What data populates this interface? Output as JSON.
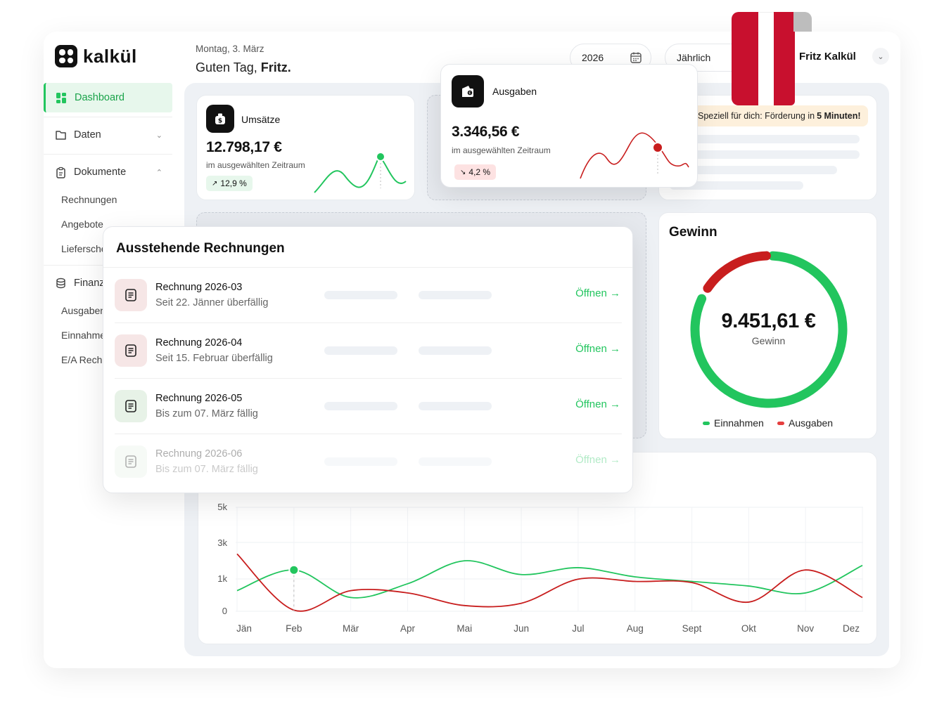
{
  "app": {
    "brand": "kalkül"
  },
  "header": {
    "date": "Montag, 3. März",
    "greeting_prefix": "Guten Tag,",
    "greeting_name": "Fritz.",
    "year": "2026",
    "period": "Jährlich",
    "user": "Fritz Kalkül"
  },
  "sidebar": {
    "dashboard": "Dashboard",
    "daten": "Daten",
    "dokumente": "Dokumente",
    "dokumente_items": [
      "Rechnungen",
      "Angebote",
      "Lieferscheine"
    ],
    "finanzen": "Finanzen",
    "finanzen_items": [
      "Ausgaben",
      "Einnahmen",
      "E/A Rechnung"
    ]
  },
  "umsaetze": {
    "title": "Umsätze",
    "value": "12.798,17 €",
    "sub": "im ausgewählten Zeitraum",
    "badge": "12,9 %"
  },
  "ausgaben": {
    "title": "Ausgaben",
    "value": "3.346,56 €",
    "sub": "im ausgewählten Zeitraum",
    "badge": "4,2 %"
  },
  "promo": {
    "text": "Speziell für dich: Förderung in ",
    "highlight": "5 Minuten!"
  },
  "invoices": {
    "title": "Ausstehende Rechnungen",
    "open_label": "Öffnen →",
    "rows": [
      {
        "name": "Rechnung 2026-03",
        "status": "Seit 22. Jänner überfällig",
        "tone": "red"
      },
      {
        "name": "Rechnung 2026-04",
        "status": "Seit 15. Februar überfällig",
        "tone": "red"
      },
      {
        "name": "Rechnung 2026-05",
        "status": "Bis zum 07. März fällig",
        "tone": "green"
      },
      {
        "name": "Rechnung 2026-06",
        "status": "Bis zum 07. März fällig",
        "tone": "green"
      }
    ]
  },
  "gewinn": {
    "title": "Gewinn",
    "value": "9.451,61 €",
    "label": "Gewinn",
    "legend_income": "Einnahmen",
    "legend_expense": "Ausgaben",
    "income_fraction": 0.81,
    "expense_fraction": 0.15
  },
  "colors": {
    "green": "#22c55e",
    "red": "#c81e1e",
    "flag_red": "#c8102e"
  },
  "chart_data": {
    "type": "line",
    "categories": [
      "Jän",
      "Feb",
      "Mär",
      "Apr",
      "Mai",
      "Jun",
      "Jul",
      "Aug",
      "Sept",
      "Okt",
      "Nov",
      "Dez"
    ],
    "yticks": [
      "5k",
      "3k",
      "1k",
      "0"
    ],
    "series": [
      {
        "name": "Einnahmen",
        "color": "#22c55e",
        "values": [
          900,
          1800,
          600,
          1200,
          2200,
          1600,
          1900,
          1500,
          1300,
          1100,
          800,
          2000
        ]
      },
      {
        "name": "Ausgaben",
        "color": "#c81e1e",
        "values": [
          2500,
          50,
          900,
          800,
          250,
          350,
          1400,
          1300,
          1250,
          400,
          1800,
          600
        ]
      }
    ],
    "ylim": [
      0,
      3000
    ]
  }
}
